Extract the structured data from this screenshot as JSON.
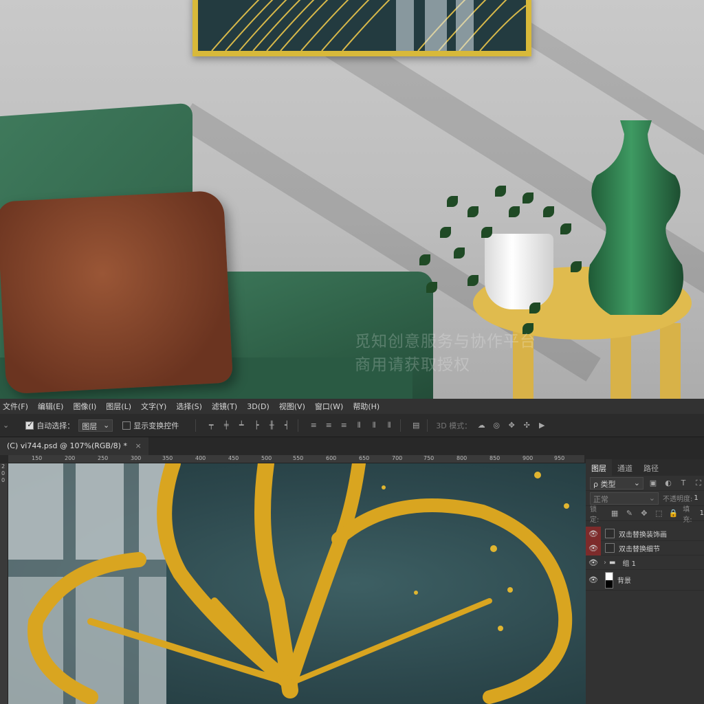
{
  "watermark": {
    "line1": "觅知创意服务与协作平台",
    "line2": "商用请获取授权"
  },
  "menu": [
    "文件(F)",
    "编辑(E)",
    "图像(I)",
    "图层(L)",
    "文字(Y)",
    "选择(S)",
    "滤镜(T)",
    "3D(D)",
    "视图(V)",
    "窗口(W)",
    "帮助(H)"
  ],
  "options": {
    "auto_select_label": "自动选择：",
    "auto_select_value": "图层",
    "show_transform_label": "显示变换控件",
    "mode_3d_label": "3D 模式："
  },
  "document_tab": {
    "title": "(C) vi744.psd @ 107%(RGB/8) *",
    "close": "×"
  },
  "ruler_ticks": [
    "150",
    "200",
    "250",
    "300",
    "350",
    "400",
    "450",
    "500",
    "550",
    "600",
    "650",
    "700",
    "750",
    "800",
    "850",
    "900",
    "950"
  ],
  "ruler_v_ticks": [
    "2",
    "0",
    "0"
  ],
  "panel": {
    "tabs": [
      "图层",
      "通道",
      "路径"
    ],
    "filter_label": "ρ 类型",
    "blend_mode": "正常",
    "opacity_label": "不透明度:",
    "opacity_value": "1",
    "lock_label": "锁定:",
    "fill_label": "填充:",
    "fill_value": "1"
  },
  "layers": [
    {
      "name": "双击替换装饰画",
      "type": "smart-object",
      "visible": true,
      "highlight": true
    },
    {
      "name": "双击替换细节",
      "type": "smart-object",
      "visible": true,
      "highlight": true
    },
    {
      "name": "组 1",
      "type": "group",
      "visible": true,
      "highlight": false
    },
    {
      "name": "背景",
      "type": "background",
      "visible": true,
      "highlight": false
    }
  ],
  "colors": {
    "ps_bg": "#282828",
    "panel_bg": "#323232",
    "highlight_eye": "#7d2b2b",
    "gold": "#d9a520",
    "teal": "#2c474c",
    "sofa_green": "#2f5e47",
    "table_yellow": "#e0bb4e"
  }
}
